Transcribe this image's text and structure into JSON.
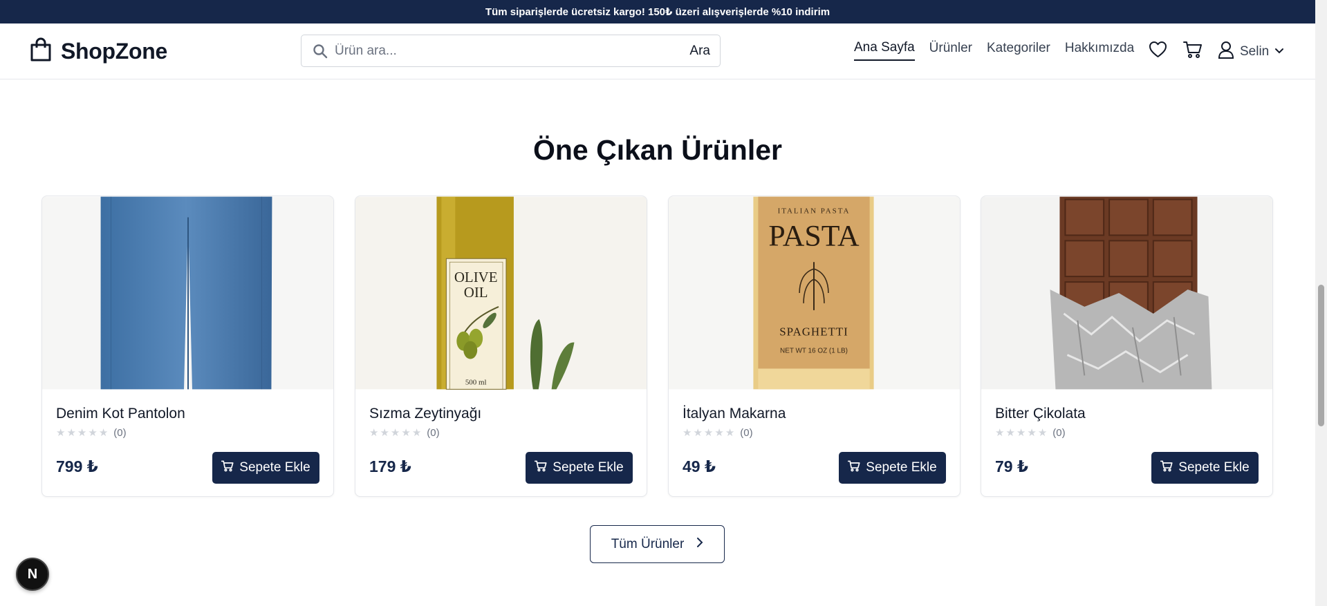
{
  "promo": {
    "text": "Tüm siparişlerde ücretsiz kargo! 150₺ üzeri alışverişlerde %10 indirim"
  },
  "header": {
    "logo_text": "ShopZone",
    "search": {
      "placeholder": "Ürün ara...",
      "value": "",
      "button_label": "Ara"
    },
    "nav": [
      {
        "label": "Ana Sayfa",
        "active": true
      },
      {
        "label": "Ürünler",
        "active": false
      },
      {
        "label": "Kategoriler",
        "active": false
      },
      {
        "label": "Hakkımızda",
        "active": false
      }
    ],
    "user": {
      "name": "Selin"
    }
  },
  "featured": {
    "title": "Öne Çıkan Ürünler",
    "products": [
      {
        "name": "Denim Kot Pantolon",
        "rating": 0,
        "reviews": "(0)",
        "price": "799 ₺",
        "button_label": "Sepete Ekle",
        "image": "denim-jeans"
      },
      {
        "name": "Sızma Zeytinyağı",
        "rating": 0,
        "reviews": "(0)",
        "price": "179 ₺",
        "button_label": "Sepete Ekle",
        "image": "olive-oil-bottle",
        "image_text": {
          "line1": "OLIVE",
          "line2": "OIL",
          "volume": "500 ml"
        }
      },
      {
        "name": "İtalyan Makarna",
        "rating": 0,
        "reviews": "(0)",
        "price": "49 ₺",
        "button_label": "Sepete Ekle",
        "image": "pasta-package",
        "image_text": {
          "top": "ITALIAN PASTA",
          "brand": "PASTA",
          "type": "SPAGHETTI",
          "weight": "NET WT 16 OZ (1 LB)"
        }
      },
      {
        "name": "Bitter Çikolata",
        "rating": 0,
        "reviews": "(0)",
        "price": "79 ₺",
        "button_label": "Sepete Ekle",
        "image": "chocolate-bar"
      }
    ],
    "all_button_label": "Tüm Ürünler"
  },
  "dev_badge": {
    "letter": "N"
  },
  "colors": {
    "navy": "#16274a",
    "border": "#e5e7eb",
    "star": "#d1d5db"
  }
}
